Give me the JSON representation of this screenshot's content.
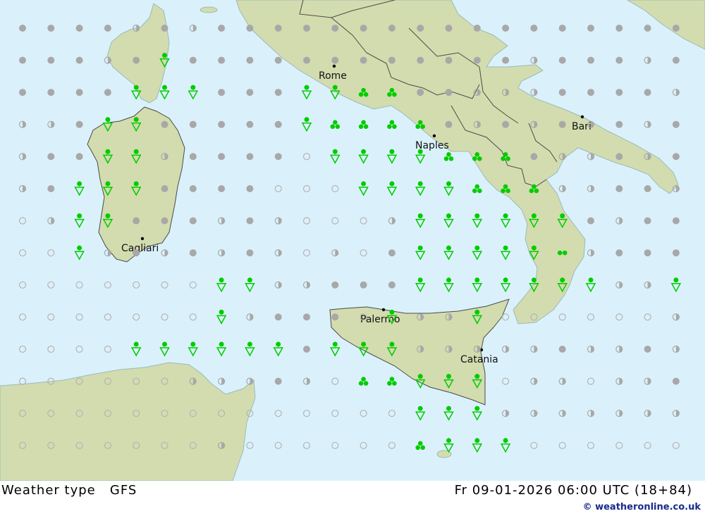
{
  "footer": {
    "left_label": "Weather type   GFS",
    "right_label": "Fr 09-01-2026 06:00 UTC (18+84)",
    "credit": "© weatheronline.co.uk"
  },
  "cities": [
    {
      "name": "Rome"
    },
    {
      "name": "Naples"
    },
    {
      "name": "Bari"
    },
    {
      "name": "Cagliari"
    },
    {
      "name": "Palermo"
    },
    {
      "name": "Catania"
    }
  ],
  "legend_colors": {
    "sea": "#daf1fb",
    "land": "#d3dcae",
    "rain_symbol": "#00cc00",
    "overcast": "#a8a8a8",
    "clear_outline": "#b4b4b4",
    "border": "#4a4a4a"
  },
  "grid": {
    "note_codes": "o=clear, h=partly cloudy, d=cloudy, s=shower, r=light rain, t=three-dot rain",
    "rows": [
      "ddddhdhddddddddddddddddddddd",
      "dddhdsddddddddddddhdddhddhhh",
      "ddddsssdddssttddhhhddddhoooo",
      "hhdssdddddsttttdhdhdhdhdddd",
      "hddsshddddosssstttdhhdhdd",
      "hdsssddddooossssttthhddhhd",
      "ohssdddhdhooohssssssdhddddh",
      "ooshdhdhdhohodsssssrhddddhh",
      "ooooooosshhdddssssssshhsssss",
      "oooooooshdddoshhsoooooohssss",
      "oooossssssdssshhhhhdhhdhhhd",
      "oooooohhhdhottsssohhohhdhhd",
      "oooooooooooooossshhhhhhhhho",
      "ooooooohooooootsssooooooooo"
    ]
  }
}
